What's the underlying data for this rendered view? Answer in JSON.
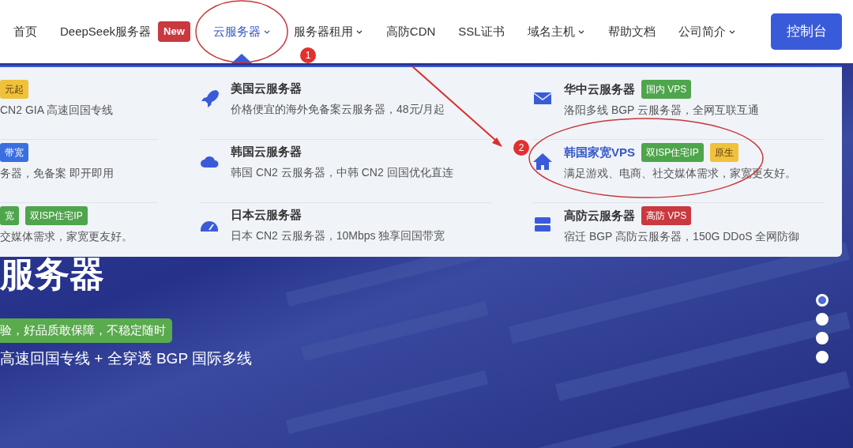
{
  "nav": {
    "items": [
      {
        "label": "首页",
        "selected": false,
        "has_menu": false
      },
      {
        "label": "DeepSeek服务器",
        "selected": false,
        "has_menu": false,
        "badge": {
          "text": "New",
          "color": "#c9393f"
        }
      },
      {
        "label": "云服务器",
        "selected": true,
        "has_menu": true
      },
      {
        "label": "服务器租用",
        "selected": false,
        "has_menu": true
      },
      {
        "label": "高防CDN",
        "selected": false,
        "has_menu": false
      },
      {
        "label": "SSL证书",
        "selected": false,
        "has_menu": false
      },
      {
        "label": "域名主机",
        "selected": false,
        "has_menu": true
      },
      {
        "label": "帮助文档",
        "selected": false,
        "has_menu": false
      },
      {
        "label": "公司简介",
        "selected": false,
        "has_menu": true
      }
    ],
    "console_button": "控制台"
  },
  "menu": {
    "columns": [
      {
        "items": [
          {
            "badges": [
              {
                "text": "元起",
                "color": "#f0c23b"
              }
            ],
            "description": "CN2 GIA 高速回国专线",
            "selected": false
          },
          {
            "badges": [
              {
                "text": "带宽",
                "color": "#3a6fe0"
              }
            ],
            "description": "务器，免备案 即开即用",
            "selected": false
          },
          {
            "badges": [
              {
                "text": "宽",
                "color": "#4ea54c"
              },
              {
                "text": "双ISP住宅IP",
                "color": "#4ea54c"
              }
            ],
            "description": "交媒体需求，家宽更友好。",
            "selected": false
          }
        ]
      },
      {
        "items": [
          {
            "title": "美国云服务器",
            "description": "价格便宜的海外免备案云服务器，48元/月起",
            "selected": false
          },
          {
            "title": "韩国云服务器",
            "description": "韩国 CN2 云服务器，中韩 CN2 回国优化直连",
            "selected": false
          },
          {
            "title": "日本云服务器",
            "description": "日本 CN2 云服务器，10Mbps 独享回国带宽",
            "selected": false
          }
        ]
      },
      {
        "items": [
          {
            "title": "华中云服务器",
            "badges": [
              {
                "text": "国内 VPS",
                "color": "#4ea54c"
              }
            ],
            "description": "洛阳多线 BGP 云服务器，全网互联互通",
            "selected": false
          },
          {
            "title": "韩国家宽VPS",
            "badges": [
              {
                "text": "双ISP住宅IP",
                "color": "#4ea54c"
              },
              {
                "text": "原生",
                "color": "#f0c23b"
              }
            ],
            "description": "满足游戏、电商、社交媒体需求，家宽更友好。",
            "selected": true
          },
          {
            "title": "高防云服务器",
            "badges": [
              {
                "text": "高防 VPS",
                "color": "#c9393f"
              }
            ],
            "description": "宿迁 BGP 高防云服务器，150G DDoS 全网防御",
            "selected": false
          }
        ]
      }
    ]
  },
  "hero": {
    "title": "服务器",
    "tagline": "验，好品质敢保障，不稳定随时",
    "subtitle": "高速回国专线 + 全穿透 BGP 国际多线"
  },
  "carousel": {
    "dots": [
      {
        "selected": true
      },
      {
        "selected": false
      },
      {
        "selected": false
      },
      {
        "selected": false
      }
    ]
  },
  "annotations": {
    "markers": [
      "1",
      "2"
    ]
  }
}
